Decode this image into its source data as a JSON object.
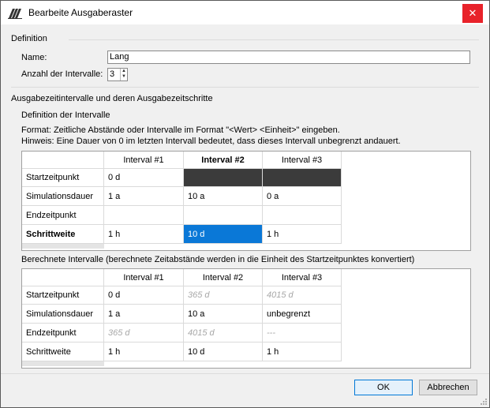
{
  "window": {
    "title": "Bearbeite Ausgaberaster"
  },
  "definition": {
    "heading": "Definition",
    "name_label": "Name:",
    "name_value": "Lang",
    "count_label": "Anzahl der Intervalle:",
    "count_value": "3"
  },
  "intervals": {
    "heading": "Ausgabezeitintervalle und deren Ausgabezeitschritte",
    "subheading": "Definition der Intervalle",
    "format_hint": "Format: Zeitliche Abstände oder Intervalle im Format \"<Wert> <Einheit>\" eingeben.",
    "duration_hint": "Hinweis: Eine Dauer von 0 im letzten Intervall bedeutet, dass dieses Intervall unbegrenzt andauert."
  },
  "definition_table": {
    "columns": [
      "Interval #1",
      "Interval #2",
      "Interval #3"
    ],
    "rows": [
      {
        "label": "Startzeitpunkt",
        "cells": [
          "0 d",
          "",
          ""
        ]
      },
      {
        "label": "Simulationsdauer",
        "cells": [
          "1 a",
          "10 a",
          "0 a"
        ]
      },
      {
        "label": "Endzeitpunkt",
        "cells": [
          "",
          "",
          ""
        ]
      },
      {
        "label": "Schrittweite",
        "cells": [
          "1 h",
          "10 d",
          "1 h"
        ]
      }
    ]
  },
  "computed": {
    "heading": "Berechnete Intervalle (berechnete Zeitabstände werden in die Einheit des Startzeitpunktes konvertiert)"
  },
  "computed_table": {
    "columns": [
      "Interval #1",
      "Interval #2",
      "Interval #3"
    ],
    "rows": [
      {
        "label": "Startzeitpunkt",
        "cells": [
          "0 d",
          "365 d",
          "4015 d"
        ]
      },
      {
        "label": "Simulationsdauer",
        "cells": [
          "1 a",
          "10 a",
          "unbegrenzt"
        ]
      },
      {
        "label": "Endzeitpunkt",
        "cells": [
          "365 d",
          "4015 d",
          "---"
        ]
      },
      {
        "label": "Schrittweite",
        "cells": [
          "1 h",
          "10 d",
          "1 h"
        ]
      }
    ]
  },
  "buttons": {
    "ok": "OK",
    "cancel": "Abbrechen"
  },
  "colors": {
    "selection": "#0a78d7",
    "close": "#e8222a",
    "dark_cell": "#3b3b3b"
  }
}
